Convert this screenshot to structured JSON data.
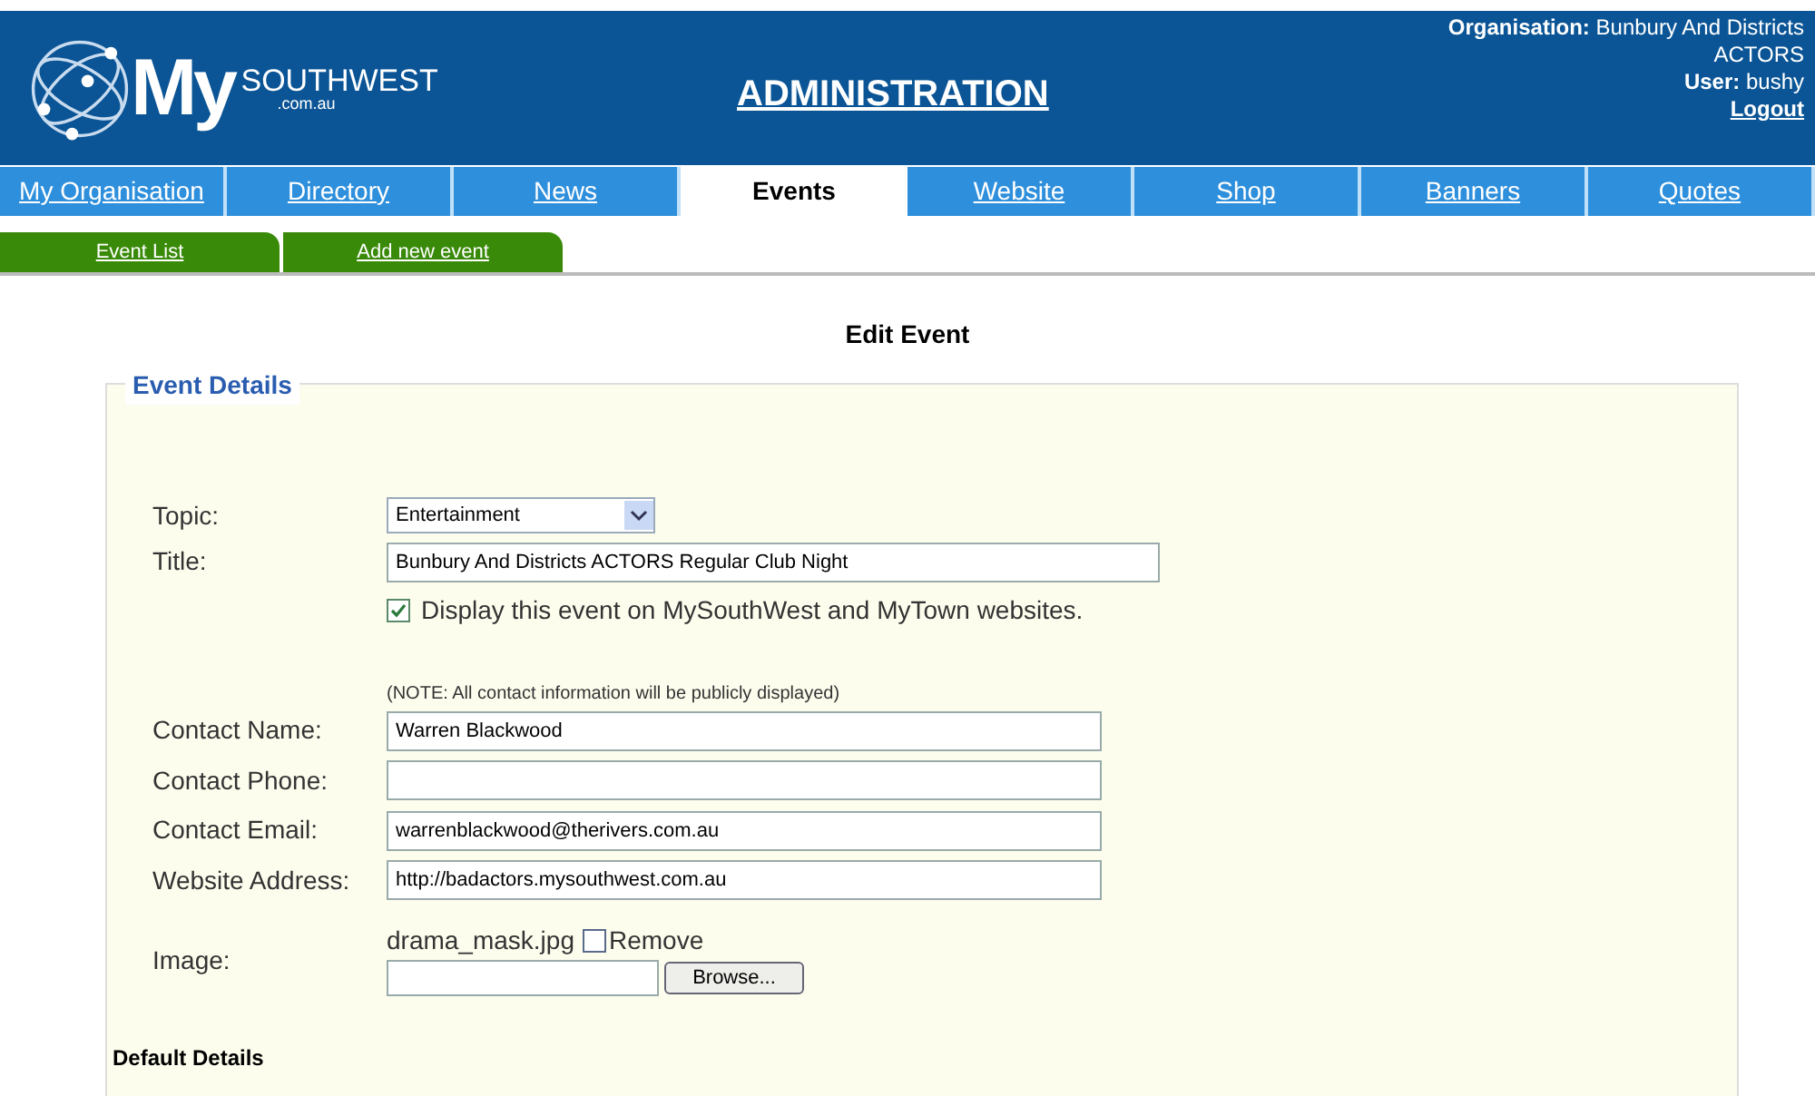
{
  "header": {
    "logo_my": "My",
    "logo_text": "SOUTHWEST",
    "logo_sub": ".com.au",
    "title": "ADMINISTRATION",
    "organisation_label": "Organisation:",
    "organisation": "Bunbury And Districts ACTORS",
    "user_label": "User:",
    "user": "bushy",
    "logout": "Logout"
  },
  "tabs": [
    {
      "label": "My Organisation",
      "selected": false
    },
    {
      "label": "Directory",
      "selected": false
    },
    {
      "label": "News",
      "selected": false
    },
    {
      "label": "Events",
      "selected": true
    },
    {
      "label": "Website",
      "selected": false
    },
    {
      "label": "Shop",
      "selected": false
    },
    {
      "label": "Banners",
      "selected": false
    },
    {
      "label": "Quotes",
      "selected": false
    }
  ],
  "subtabs": [
    {
      "label": "Event List"
    },
    {
      "label": "Add new event"
    }
  ],
  "page_title": "Edit Event",
  "fieldset": {
    "legend": "Event Details",
    "topic": {
      "label": "Topic:",
      "value": "Entertainment"
    },
    "title": {
      "label": "Title:",
      "value": "Bunbury And Districts ACTORS Regular Club Night"
    },
    "display": {
      "label": "Display this event on MySouthWest and MyTown websites.",
      "checked": true
    },
    "note": "(NOTE: All contact information will be publicly displayed)",
    "contacts": [
      {
        "label": "Contact Name:",
        "value": "Warren Blackwood"
      },
      {
        "label": "Contact Phone:"
      },
      {
        "label": "Contact Email:",
        "value": "warrenblackwood@therivers.com.au"
      },
      {
        "label": "Website Address:",
        "value": "http://badactors.mysouthwest.com.au"
      }
    ],
    "image": {
      "label": "Image:",
      "filename": "drama_mask.jpg",
      "remove_label": "Remove",
      "remove_checked": false,
      "browse": "Browse..."
    }
  },
  "section2": "Default Details"
}
